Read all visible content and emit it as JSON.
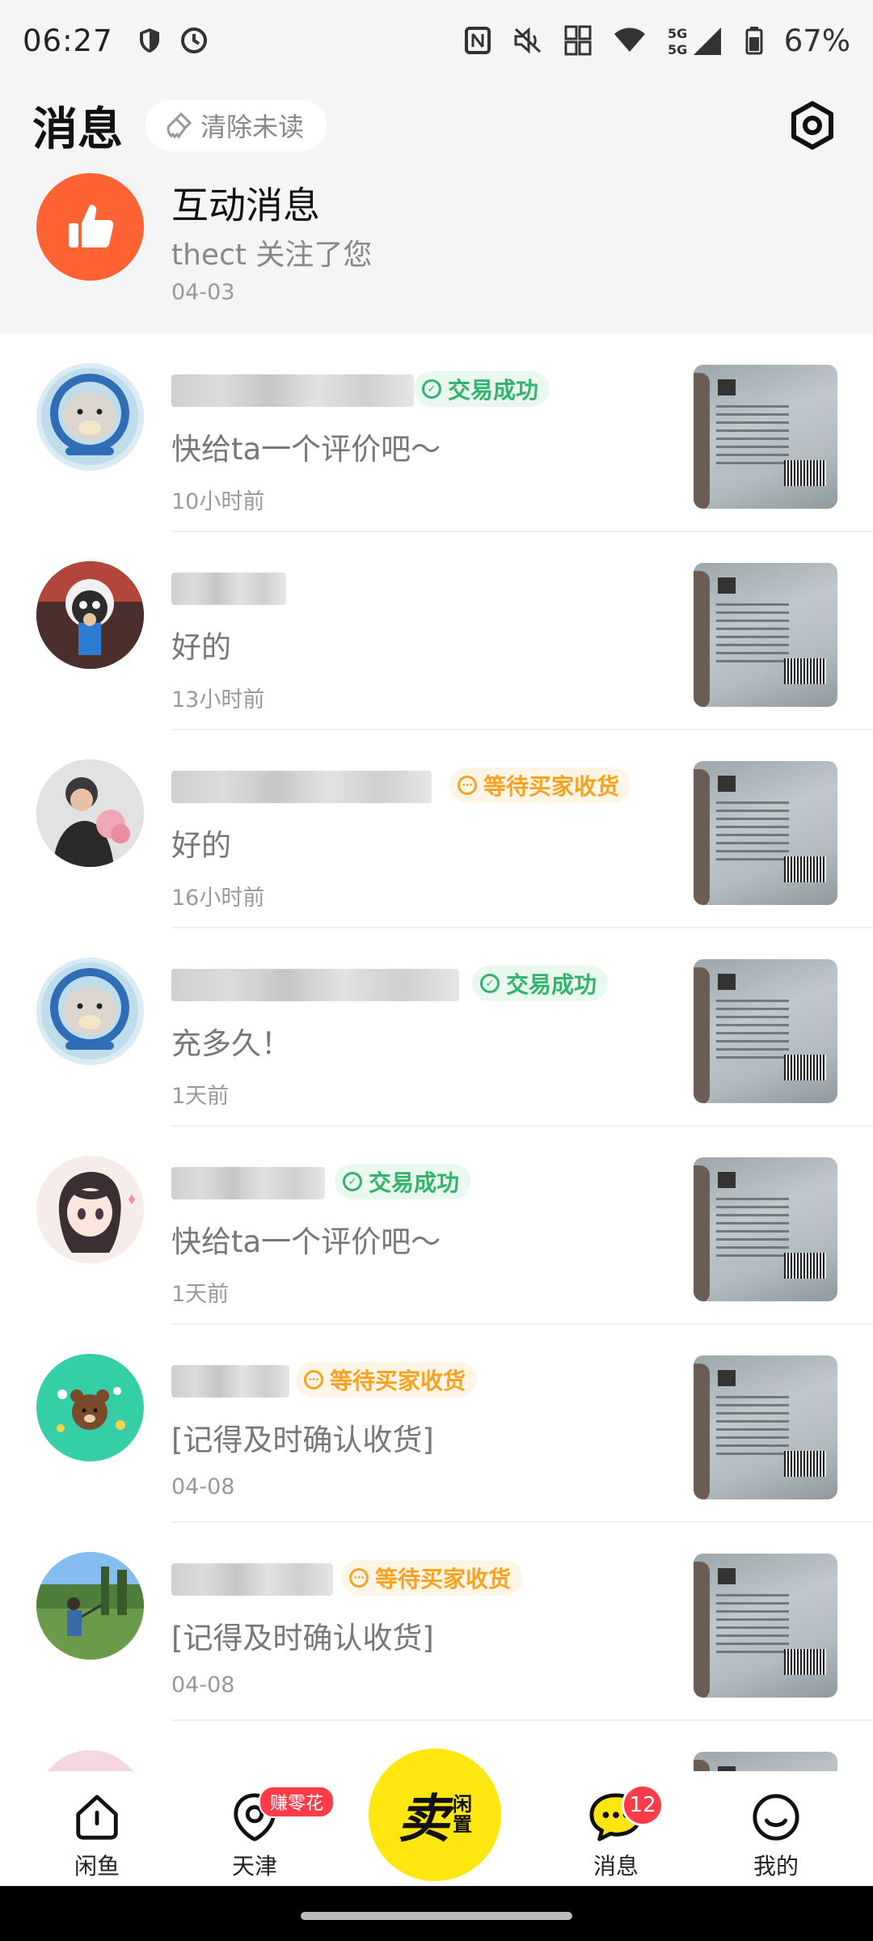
{
  "status_bar": {
    "time": "06:27",
    "network": "5G",
    "battery": "67%"
  },
  "header": {
    "title": "消息",
    "clear_unread": "清除未读"
  },
  "interaction": {
    "title": "互动消息",
    "subtitle": "thect 关注了您",
    "date": "04-03"
  },
  "conversations": [
    {
      "status": "交易成功",
      "status_type": "success",
      "message": "快给ta一个评价吧～",
      "time": "10小时前"
    },
    {
      "status": "",
      "status_type": "",
      "message": "好的",
      "time": "13小时前"
    },
    {
      "status": "等待买家收货",
      "status_type": "waiting",
      "message": "好的",
      "time": "16小时前"
    },
    {
      "status": "交易成功",
      "status_type": "success",
      "message": "充多久！",
      "time": "1天前"
    },
    {
      "status": "交易成功",
      "status_type": "success",
      "message": "快给ta一个评价吧～",
      "time": "1天前"
    },
    {
      "status": "等待买家收货",
      "status_type": "waiting",
      "message": "[记得及时确认收货]",
      "time": "04-08"
    },
    {
      "status": "等待买家收货",
      "status_type": "waiting",
      "message": "[记得及时确认收货]",
      "time": "04-08"
    }
  ],
  "bottom_nav": {
    "home": "闲鱼",
    "city": "天津",
    "city_tag": "赚零花",
    "sell_big": "卖",
    "sell_small_1": "闲",
    "sell_small_2": "置",
    "messages": "消息",
    "messages_count": "12",
    "mine": "我的"
  },
  "colors": {
    "accent_yellow": "#ffe60f",
    "success_green": "#33b46b",
    "waiting_orange": "#f7a221",
    "badge_red": "#ff3b48",
    "like_orange": "#ff6233"
  }
}
